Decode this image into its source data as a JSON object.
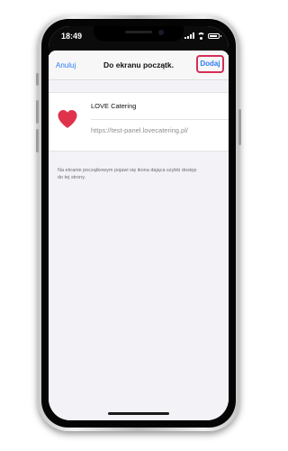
{
  "status_bar": {
    "time": "18:49"
  },
  "navigation": {
    "cancel_label": "Anuluj",
    "title": "Do ekranu początk.",
    "add_label": "Dodaj"
  },
  "app": {
    "name": "LOVE Catering",
    "url": "https://test-panel.lovecatering.pl/",
    "icon": "heart-icon"
  },
  "hint_text": "Na ekranie początkowym pojawi się ikona dająca szybki dostęp do tej strony.",
  "colors": {
    "accent_blue": "#2f7bf6",
    "highlight_red": "#d62c56",
    "heart_red": "#e0324c"
  }
}
